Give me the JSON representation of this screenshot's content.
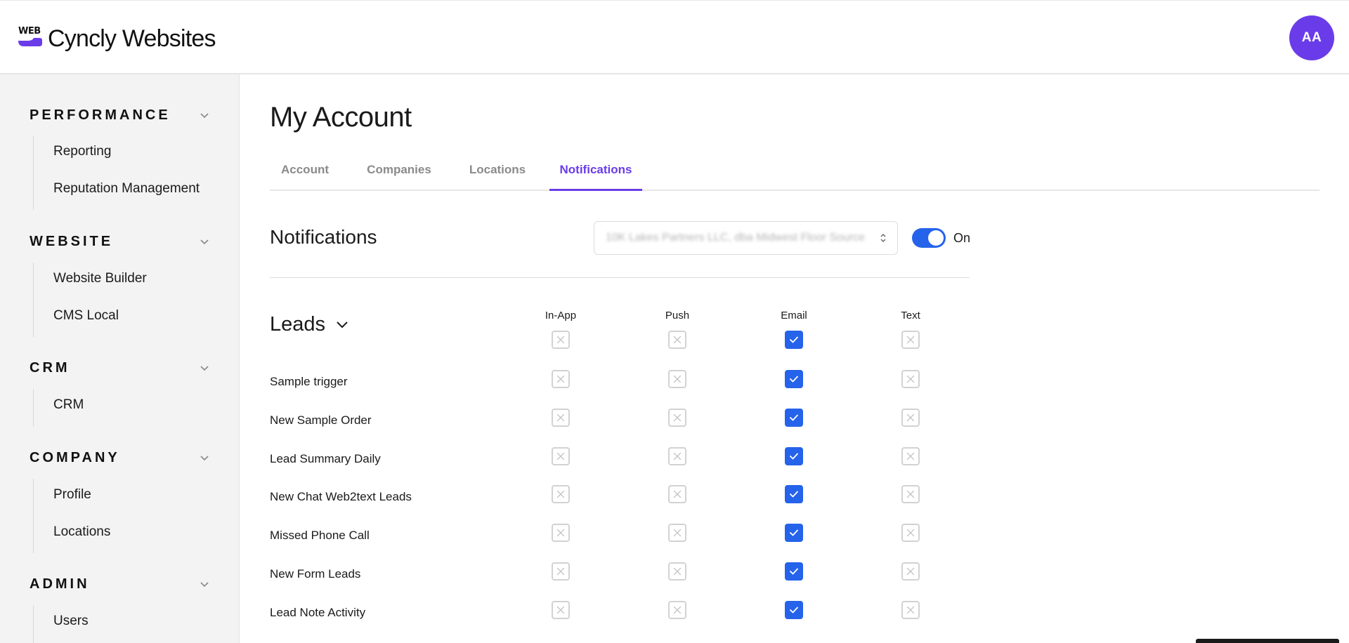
{
  "app": {
    "logo_mark": "WEB",
    "title": "Cyncly Websites",
    "avatar_initials": "AA",
    "accent": "#6a3ce9",
    "toggle_color": "#2563eb"
  },
  "sidebar": {
    "sections": [
      {
        "title": "PERFORMANCE",
        "items": [
          "Reporting",
          "Reputation Management"
        ]
      },
      {
        "title": "WEBSITE",
        "items": [
          "Website Builder",
          "CMS Local"
        ]
      },
      {
        "title": "CRM",
        "items": [
          "CRM"
        ]
      },
      {
        "title": "COMPANY",
        "items": [
          "Profile",
          "Locations"
        ]
      },
      {
        "title": "ADMIN",
        "items": [
          "Users"
        ]
      }
    ]
  },
  "page": {
    "title": "My Account"
  },
  "tabs": [
    {
      "label": "Account",
      "active": false
    },
    {
      "label": "Companies",
      "active": false
    },
    {
      "label": "Locations",
      "active": false
    },
    {
      "label": "Notifications",
      "active": true
    }
  ],
  "notifications": {
    "title": "Notifications",
    "company_select_value": "10K Lakes Partners LLC, dba Midwest Floor Source",
    "enabled_label": "On",
    "enabled": true
  },
  "group": {
    "title": "Leads",
    "columns": [
      "In-App",
      "Push",
      "Email",
      "Text"
    ],
    "header_checks": [
      false,
      false,
      true,
      false
    ],
    "rows": [
      {
        "label": "Sample trigger",
        "checks": [
          false,
          false,
          true,
          false
        ]
      },
      {
        "label": "New Sample Order",
        "checks": [
          false,
          false,
          true,
          false
        ]
      },
      {
        "label": "Lead Summary Daily",
        "checks": [
          false,
          false,
          true,
          false
        ]
      },
      {
        "label": "New Chat Web2text Leads",
        "checks": [
          false,
          false,
          true,
          false
        ]
      },
      {
        "label": "Missed Phone Call",
        "checks": [
          false,
          false,
          true,
          false
        ]
      },
      {
        "label": "New Form Leads",
        "checks": [
          false,
          false,
          true,
          false
        ]
      },
      {
        "label": "Lead Note Activity",
        "checks": [
          false,
          false,
          true,
          false
        ]
      }
    ]
  },
  "icons": {
    "section_toggle": "chevron-down-icon",
    "group_toggle": "chevron-down-icon",
    "select": "up-down-arrows-icon",
    "checked": "check-icon",
    "unchecked": "x-icon"
  }
}
